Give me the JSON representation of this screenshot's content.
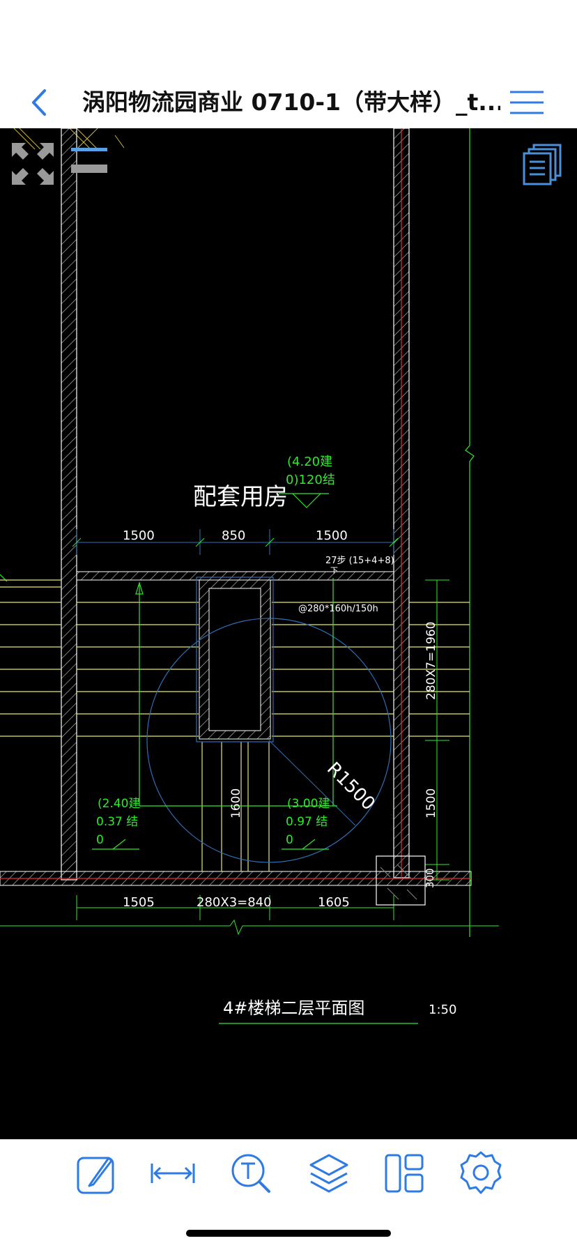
{
  "navbar": {
    "title": "涡阳物流园商业 0710-1（带大样）_t...",
    "back_icon": "chevron-left-icon",
    "menu_icon": "hamburger-menu-icon"
  },
  "overlay": {
    "fullscreen_icon": "expand-arrows-icon",
    "bars_icon": "line-weight-icon",
    "layers_icon": "layout-pages-icon"
  },
  "drawing": {
    "room_label": "配套用房",
    "elev_top_1": "(4.20建",
    "elev_top_2": "0)120结",
    "dim_top_1": "1500",
    "dim_top_2": "850",
    "dim_top_3": "1500",
    "steps_note": "27步 (15+4+8)",
    "down_note": "下",
    "tread_note": "@280*160h/150h",
    "radius_label": "R1500",
    "dim_right_1": "280X7=1960",
    "dim_right_2": "1500",
    "dim_right_3": "300",
    "dim_center": "1600",
    "elev_left_1": "(2.40建",
    "elev_left_2": "0.37 结",
    "elev_left_3": "0",
    "elev_mid_1": "(3.00建",
    "elev_mid_2": "0.97 结",
    "elev_mid_3": "0",
    "dim_bottom_1": "1505",
    "dim_bottom_2": "280X3=840",
    "dim_bottom_3": "1605",
    "plan_title": "4#楼梯二层平面图",
    "scale": "1:50"
  },
  "toolbar": {
    "items": [
      {
        "icon": "edit-pen-icon"
      },
      {
        "icon": "measure-icon"
      },
      {
        "icon": "text-search-icon"
      },
      {
        "icon": "layers-icon"
      },
      {
        "icon": "layout-icon"
      },
      {
        "icon": "settings-gear-icon"
      }
    ]
  },
  "colors": {
    "accent": "#2E7BE6",
    "cad_green": "#2EE82E",
    "cad_yellow": "#E8E86A",
    "cad_blue": "#2E6FB5",
    "cad_red": "#E82E2E",
    "wall_white": "#FFFFFF"
  }
}
